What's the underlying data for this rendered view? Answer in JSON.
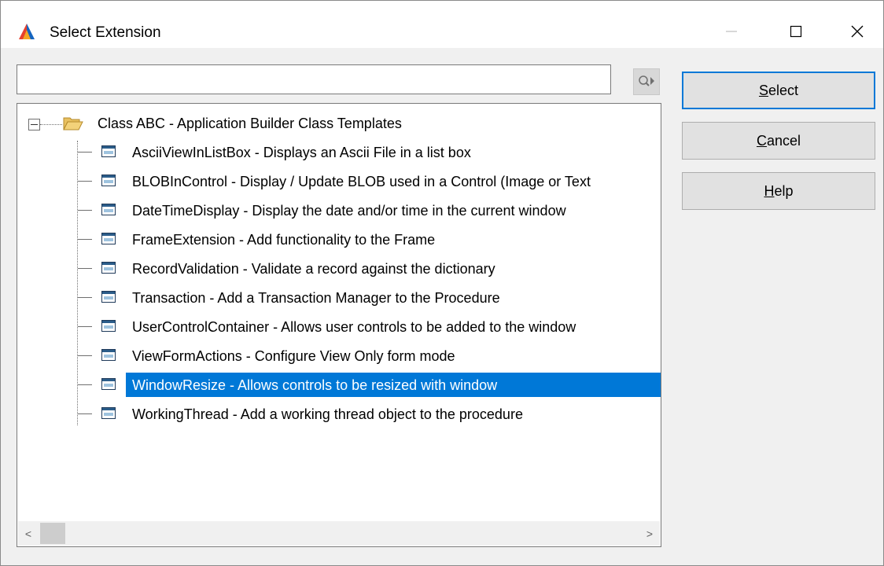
{
  "window": {
    "title": "Select Extension",
    "minimize_icon": "minimize-icon",
    "maximize_icon": "maximize-icon",
    "close_icon": "close-icon"
  },
  "search": {
    "value": "",
    "placeholder": "",
    "button_icon": "search-locate-icon"
  },
  "tree": {
    "root": {
      "label": "Class ABC - Application Builder Class Templates",
      "expanded": true,
      "icon": "folder-open-icon"
    },
    "items": [
      {
        "label": "AsciiViewInListBox - Displays an Ascii File in a list box",
        "selected": false
      },
      {
        "label": "BLOBInControl - Display / Update BLOB used in a Control (Image or Text",
        "selected": false
      },
      {
        "label": "DateTimeDisplay - Display the date and/or time in the current window",
        "selected": false
      },
      {
        "label": "FrameExtension - Add functionality to the Frame",
        "selected": false
      },
      {
        "label": "RecordValidation - Validate a record against the dictionary",
        "selected": false
      },
      {
        "label": "Transaction - Add a Transaction Manager to the Procedure",
        "selected": false
      },
      {
        "label": "UserControlContainer - Allows user controls to be added to the window",
        "selected": false
      },
      {
        "label": "ViewFormActions - Configure View Only form mode",
        "selected": false
      },
      {
        "label": "WindowResize - Allows controls to be resized with window",
        "selected": true
      },
      {
        "label": "WorkingThread - Add a working thread object to the procedure",
        "selected": false
      }
    ],
    "item_icon": "extension-window-icon"
  },
  "scrollbar": {
    "left_arrow": "<",
    "right_arrow": ">"
  },
  "buttons": {
    "select": {
      "mnemonic": "S",
      "rest": "elect"
    },
    "cancel": {
      "mnemonic": "C",
      "rest": "ancel"
    },
    "help": {
      "mnemonic": "H",
      "rest": "elp"
    }
  },
  "colors": {
    "selection": "#0078d7",
    "accent_red": "#e8412c",
    "accent_orange": "#f5a623",
    "accent_blue": "#1565c0"
  }
}
